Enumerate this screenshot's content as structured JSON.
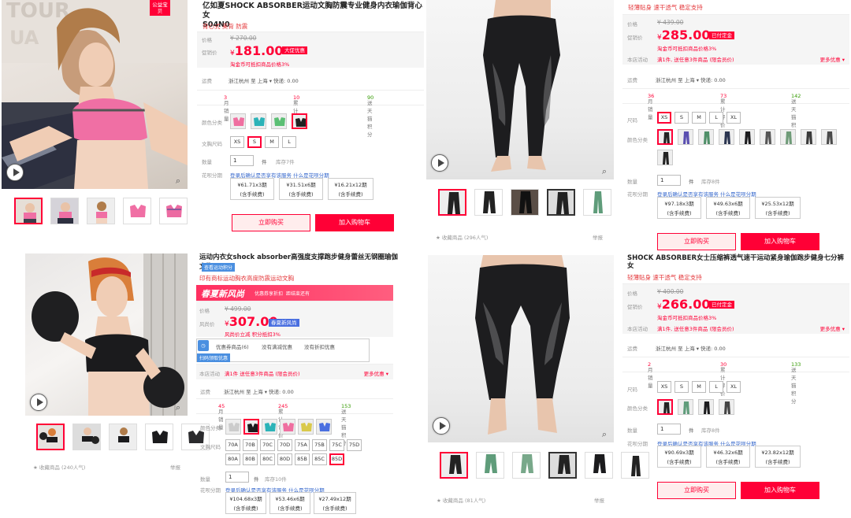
{
  "colors": {
    "accent": "#ff0036",
    "green": "#339900"
  },
  "p1": {
    "badge": "公益宝贝",
    "title_line1": "亿如夏SHOCK ABSORBER运动文胸防震专业健身内衣瑜伽背心女",
    "title_line2": "S04N0",
    "subtitle": "背心式 美背 防震",
    "price_label": "价格",
    "orig_price": "¥ 270.00",
    "promo_label": "促销价",
    "price_symbol": "¥",
    "price": "181.00",
    "tag": "大促优惠",
    "promo_note": "淘金币可抵扣商品价格3%",
    "delivery_label": "运费",
    "delivery": "浙江杭州 至 上海 ▾ 快递: 0.00",
    "stats": [
      {
        "label": "月销量",
        "value": "3"
      },
      {
        "label": "累计评价",
        "value": "10"
      },
      {
        "label": "送天猫积分",
        "value": "90"
      }
    ],
    "color_label": "颜色分类",
    "size_label": "文胸尺码",
    "sizes": [
      "XS",
      "S",
      "M",
      "L"
    ],
    "qty_label": "数量",
    "qty": "1",
    "unit": "件",
    "stock": "库存7件",
    "inst_label": "花呗分期",
    "inst_note": "登录后确认是否享有该服务 什么是花呗分期",
    "installments": [
      {
        "amt": "¥61.71x3期",
        "note": "(含手续费)"
      },
      {
        "amt": "¥31.51x6期",
        "note": "(含手续费)"
      },
      {
        "amt": "¥16.21x12期",
        "note": "(含手续费)"
      }
    ],
    "buy": "立即购买",
    "cart": "加入购物车"
  },
  "p2": {
    "subtitle": "轻薄贴身 速干透气 稳定支持",
    "price_label": "价格",
    "orig_price": "¥ 439.00",
    "promo_label": "促销价",
    "price_symbol": "¥",
    "price": "285.00",
    "tag": "已付定金",
    "promo_note": "淘金币可抵扣商品价格3%",
    "local_label": "本店活动",
    "local": "满1件, 送任意3件商品 (限会员价)",
    "more": "更多优惠 ▾",
    "delivery_label": "运费",
    "delivery": "浙江杭州 至 上海 ▾ 快递: 0.00",
    "stats": [
      {
        "label": "月销量",
        "value": "36"
      },
      {
        "label": "累计评价",
        "value": "73"
      },
      {
        "label": "送天猫积分",
        "value": "142"
      }
    ],
    "size_label": "尺码",
    "sizes": [
      "XS",
      "S",
      "M",
      "L",
      "XL"
    ],
    "color_label": "颜色分类",
    "qty_label": "数量",
    "qty": "1",
    "unit": "件",
    "stock": "库存8件",
    "inst_label": "花呗分期",
    "inst_note": "登录后确认是否享有该服务 什么是花呗分期",
    "installments": [
      {
        "amt": "¥97.18x3期",
        "note": "(含手续费)"
      },
      {
        "amt": "¥49.63x6期",
        "note": "(含手续费)"
      },
      {
        "amt": "¥25.53x12期",
        "note": "(含手续费)"
      }
    ],
    "buy": "立即购买",
    "cart": "加入购物车",
    "fav": "★ 收藏商品  (296人气)",
    "report": "举报"
  },
  "p3": {
    "title": "运动内衣女shock absorber高强度支撑跑步健身蕾丝无钢圈瑜伽文胸",
    "tmall": "查看运动积分",
    "subtitle": "印有商标运动胸衣高度防震运动文胸",
    "banner": "春夏新风尚",
    "banner_note1": "优惠券享折扣",
    "banner_note2": "距结束还有",
    "price_label": "价格",
    "orig_price": "¥ 499.00",
    "promo_label": "风尚价",
    "price_symbol": "¥",
    "price": "307.00",
    "tag": "春夏新风尚",
    "promo_note": "风尚价立减 积分抵扣3%",
    "promo_items": [
      "优惠券商品(6)",
      "没有满减优惠",
      "没有折扣优惠"
    ],
    "blue_link": "扫码领取优惠",
    "local_label": "本店活动",
    "local": "满1件 送任意3件商品 (限会员价)",
    "more": "更多优惠 ▾",
    "delivery_label": "运费",
    "delivery": "浙江杭州 至 上海 ▾ 快递: 0.00",
    "stats": [
      {
        "label": "月销量",
        "value": "45"
      },
      {
        "label": "累计评价",
        "value": "245"
      },
      {
        "label": "送天猫积分",
        "value": "153"
      }
    ],
    "color_label": "颜色分类",
    "size_label": "文胸尺码",
    "sizes_row1": [
      "70A",
      "70B",
      "70C",
      "70D",
      "75A",
      "75B",
      "75C",
      "75D"
    ],
    "sizes_row2": [
      "80A",
      "80B",
      "80C",
      "80D",
      "85B",
      "85C",
      "85D"
    ],
    "qty_label": "数量",
    "qty": "1",
    "unit": "件",
    "stock": "库存10件",
    "inst_label": "花呗分期",
    "inst_note": "登录后确认是否享有该服务 什么是花呗分期",
    "installments": [
      {
        "amt": "¥104.68x3期",
        "note": "(含手续费)"
      },
      {
        "amt": "¥53.46x6期",
        "note": "(含手续费)"
      },
      {
        "amt": "¥27.49x12期",
        "note": "(含手续费)"
      }
    ],
    "fav": "★ 收藏商品  (240人气)",
    "report": "举报"
  },
  "p4": {
    "title": "SHOCK ABSORBER女士压缩裤透气速干运动紧身瑜伽跑步健身七分裤",
    "title2": "女",
    "subtitle": "轻薄贴身 速干透气 稳定支持",
    "price_label": "价格",
    "orig_price": "¥ 400.00",
    "promo_label": "促销价",
    "price_symbol": "¥",
    "price": "266.00",
    "tag": "已付定金",
    "promo_note": "淘金币可抵扣商品价格3%",
    "local_label": "本店活动",
    "local": "满1件, 送任意3件商品 (限会员价)",
    "more": "更多优惠 ▾",
    "delivery_label": "运费",
    "delivery": "浙江杭州 至 上海 ▾ 快递: 0.00",
    "stats": [
      {
        "label": "月销量",
        "value": "2"
      },
      {
        "label": "累计评价",
        "value": "30"
      },
      {
        "label": "送天猫积分",
        "value": "133"
      }
    ],
    "size_label": "尺码",
    "sizes": [
      "XS",
      "S",
      "M",
      "L",
      "XL"
    ],
    "color_label": "颜色分类",
    "qty_label": "数量",
    "qty": "1",
    "unit": "件",
    "stock": "库存8件",
    "inst_label": "花呗分期",
    "inst_note": "登录后确认是否享有该服务 什么是花呗分期",
    "installments": [
      {
        "amt": "¥90.69x3期",
        "note": "(含手续费)"
      },
      {
        "amt": "¥46.32x6期",
        "note": "(含手续费)"
      },
      {
        "amt": "¥23.82x12期",
        "note": "(含手续费)"
      }
    ],
    "buy": "立即购买",
    "cart": "加入购物车",
    "fav": "★ 收藏商品  (81人气)",
    "report": "举报"
  }
}
